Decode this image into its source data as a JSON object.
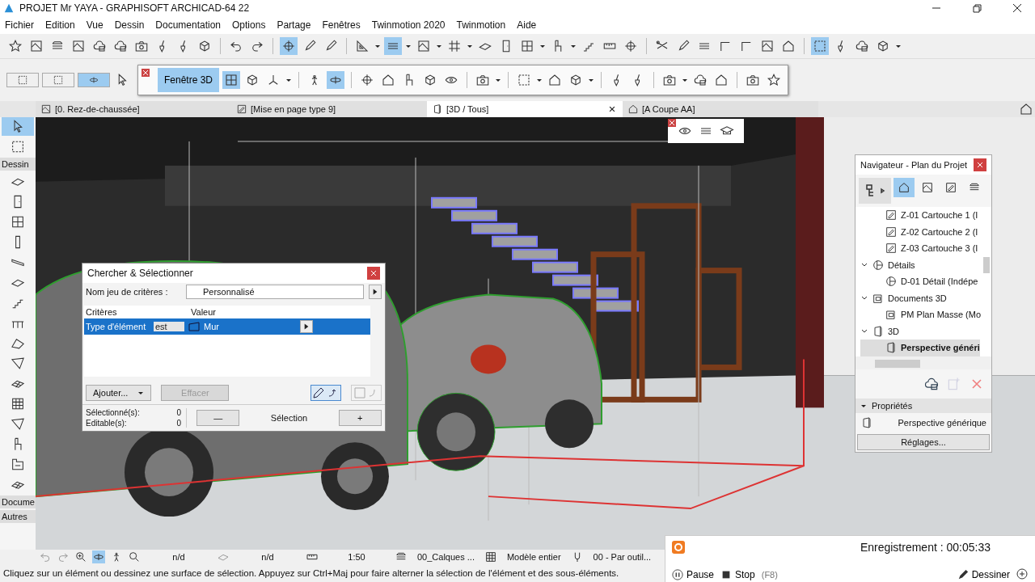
{
  "window": {
    "title": "PROJET Mr YAYA - GRAPHISOFT ARCHICAD-64 22"
  },
  "menu": [
    "Fichier",
    "Edition",
    "Vue",
    "Dessin",
    "Documentation",
    "Options",
    "Partage",
    "Fenêtres",
    "Twinmotion 2020",
    "Twinmotion",
    "Aide"
  ],
  "toolbar": [
    {
      "kind": "star",
      "selected": false
    },
    {
      "kind": "plan",
      "selected": false
    },
    {
      "kind": "layers",
      "selected": false
    },
    {
      "kind": "plan",
      "selected": false
    },
    {
      "kind": "cloud",
      "selected": false
    },
    {
      "kind": "cloud",
      "selected": false
    },
    {
      "kind": "camera",
      "selected": false
    },
    {
      "kind": "brush",
      "selected": false
    },
    {
      "kind": "brush",
      "selected": false
    },
    {
      "kind": "cube",
      "selected": false
    },
    {
      "kind": "sep"
    },
    {
      "kind": "undo",
      "selected": false
    },
    {
      "kind": "redo",
      "selected": false
    },
    {
      "kind": "sep"
    },
    {
      "kind": "target",
      "selected": true
    },
    {
      "kind": "picker",
      "selected": false
    },
    {
      "kind": "picker",
      "selected": false
    },
    {
      "kind": "sep"
    },
    {
      "kind": "triangle",
      "selected": false
    },
    {
      "kind": "caret"
    },
    {
      "kind": "lines",
      "selected": true
    },
    {
      "kind": "caret"
    },
    {
      "kind": "plan",
      "selected": false
    },
    {
      "kind": "caret"
    },
    {
      "kind": "grid",
      "selected": false
    },
    {
      "kind": "caret"
    },
    {
      "kind": "slab",
      "selected": false
    },
    {
      "kind": "door",
      "selected": false
    },
    {
      "kind": "window",
      "selected": false
    },
    {
      "kind": "caret"
    },
    {
      "kind": "object",
      "selected": false
    },
    {
      "kind": "caret"
    },
    {
      "kind": "stair",
      "selected": false
    },
    {
      "kind": "ruler",
      "selected": false
    },
    {
      "kind": "target",
      "selected": false
    },
    {
      "kind": "sep"
    },
    {
      "kind": "scissors",
      "selected": false
    },
    {
      "kind": "picker",
      "selected": false
    },
    {
      "kind": "lines",
      "selected": false
    },
    {
      "kind": "corner",
      "selected": false
    },
    {
      "kind": "corner",
      "selected": false
    },
    {
      "kind": "plan",
      "selected": false
    },
    {
      "kind": "house",
      "selected": false
    },
    {
      "kind": "sep"
    },
    {
      "kind": "marquee",
      "selected": true
    },
    {
      "kind": "brush",
      "selected": false
    },
    {
      "kind": "cloud",
      "selected": false
    },
    {
      "kind": "cube",
      "selected": false
    },
    {
      "kind": "caret"
    }
  ],
  "select_modes": [
    {
      "kind": "marquee",
      "selected": false
    },
    {
      "kind": "marquee",
      "selected": false
    },
    {
      "kind": "orbit",
      "selected": true
    }
  ],
  "palette_3d": {
    "title": "Fenêtre 3D",
    "selected": true,
    "tools": [
      {
        "kind": "window",
        "selected": true
      },
      {
        "kind": "cube",
        "selected": false
      },
      {
        "kind": "axes",
        "selected": false
      },
      {
        "kind": "caret"
      },
      {
        "kind": "sep"
      },
      {
        "kind": "walk",
        "selected": false
      },
      {
        "kind": "orbit",
        "selected": true
      },
      {
        "kind": "sep"
      },
      {
        "kind": "target",
        "selected": false
      },
      {
        "kind": "house",
        "selected": false
      },
      {
        "kind": "object",
        "selected": false
      },
      {
        "kind": "cube",
        "selected": false
      },
      {
        "kind": "eye",
        "selected": false
      },
      {
        "kind": "sep"
      },
      {
        "kind": "camera",
        "selected": false
      },
      {
        "kind": "caret"
      },
      {
        "kind": "sep"
      },
      {
        "kind": "marquee",
        "selected": false
      },
      {
        "kind": "caret"
      },
      {
        "kind": "house",
        "selected": false
      },
      {
        "kind": "cube",
        "selected": false
      },
      {
        "kind": "caret"
      },
      {
        "kind": "sep"
      },
      {
        "kind": "brush",
        "selected": false
      },
      {
        "kind": "brush",
        "selected": false
      },
      {
        "kind": "sep"
      },
      {
        "kind": "camera",
        "selected": false
      },
      {
        "kind": "caret"
      },
      {
        "kind": "cloud",
        "selected": false
      },
      {
        "kind": "house",
        "selected": false
      },
      {
        "kind": "sep"
      },
      {
        "kind": "camera",
        "selected": false
      },
      {
        "kind": "star",
        "selected": false
      }
    ]
  },
  "tabs": [
    {
      "label": "[0. Rez-de-chaussée]",
      "kind": "plan",
      "selected": false
    },
    {
      "label": "[Mise en page type 9]",
      "kind": "layout",
      "selected": false
    },
    {
      "label": "[3D / Tous]",
      "kind": "view3d",
      "selected": true
    },
    {
      "label": "[A Coupe AA]",
      "kind": "house",
      "selected": false
    }
  ],
  "toolbox": {
    "top": [
      {
        "kind": "pointer",
        "selected": true
      },
      {
        "kind": "marquee",
        "selected": false
      }
    ],
    "sections": [
      {
        "label": "Dessin"
      },
      {
        "label": "Docume"
      },
      {
        "label": "Autres"
      }
    ]
  },
  "view_palette": [
    {
      "kind": "eye"
    },
    {
      "kind": "lines"
    },
    {
      "kind": "hat"
    }
  ],
  "search_dialog": {
    "title": "Chercher & Sélectionner",
    "set_label": "Nom jeu de critères :",
    "set_value": "Personnalisé",
    "columns": [
      "Critères",
      "Valeur"
    ],
    "rows": [
      {
        "criterion": "Type d'élément",
        "operator": "est",
        "value": "Mur",
        "selected": true
      }
    ],
    "add_button": "Ajouter...",
    "clear_button": {
      "label": "Effacer",
      "disabled": true
    },
    "selected_label": "Sélectionné(s):",
    "selected_count": "0",
    "editable_label": "Editable(s):",
    "editable_count": "0",
    "minus": "—",
    "selection_label": "Sélection",
    "plus": "+"
  },
  "navigator": {
    "title": "Navigateur - Plan du Projet",
    "views": [
      {
        "kind": "house",
        "selected": true
      },
      {
        "kind": "plan",
        "selected": false
      },
      {
        "kind": "layout",
        "selected": false
      },
      {
        "kind": "layers",
        "selected": false
      }
    ],
    "tree": [
      {
        "children": [
          {
            "label": "Z-01 Cartouche 1 (I",
            "kind": "layout",
            "selected": false
          },
          {
            "label": "Z-02 Cartouche 2 (I",
            "kind": "layout",
            "selected": false
          },
          {
            "label": "Z-03 Cartouche 3 (I",
            "kind": "layout",
            "selected": false
          }
        ]
      },
      {
        "label": "Détails",
        "kind": "detail",
        "expanded": true,
        "selected": false,
        "children": [
          {
            "label": "D-01 Détail (Indépe",
            "kind": "detail",
            "selected": false
          }
        ]
      },
      {
        "label": "Documents 3D",
        "kind": "doc3d",
        "expanded": true,
        "selected": false,
        "children": [
          {
            "label": "PM Plan Masse (Mo",
            "kind": "doc3d",
            "selected": false
          }
        ]
      },
      {
        "label": "3D",
        "kind": "view3d",
        "expanded": true,
        "selected": false,
        "children": [
          {
            "label": "Perspective généri",
            "kind": "view3d",
            "selected": true
          }
        ]
      }
    ],
    "properties_title": "Propriétés",
    "properties_value": "Perspective générique",
    "settings_button": "Réglages..."
  },
  "status_bar": {
    "fields": [
      "n/d",
      "n/d",
      "1:50",
      "00_Calques ...",
      "Modèle entier",
      "00 - Par outil..."
    ],
    "hint": "Cliquez sur un élément ou dessinez une surface de sélection. Appuyez sur Ctrl+Maj pour faire alterner la sélection de l'élément et des sous-éléments."
  },
  "recorder": {
    "title": "Enregistrement : 00:05:33",
    "pause": "Pause",
    "stop": "Stop",
    "stop_key": "(F8)",
    "draw": "Dessiner"
  }
}
